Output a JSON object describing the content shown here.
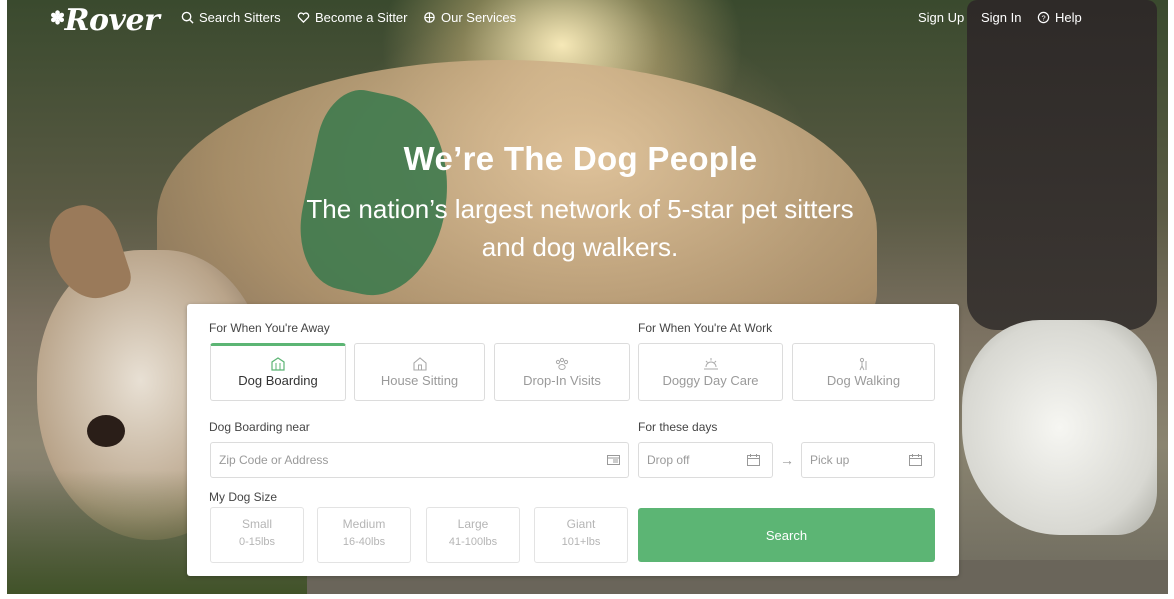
{
  "nav": {
    "logo": "Rover",
    "search_sitters": "Search Sitters",
    "become_sitter": "Become a Sitter",
    "our_services": "Our Services",
    "sign_up": "Sign Up",
    "sign_in": "Sign In",
    "help": "Help"
  },
  "hero": {
    "headline": "We’re The Dog People",
    "subline": "The nation’s largest network of 5-star pet sitters and dog walkers."
  },
  "search_card": {
    "away_label": "For When You're Away",
    "work_label": "For When You're At Work",
    "services": [
      {
        "label": "Dog Boarding",
        "icon": "house-bed-icon",
        "active": true
      },
      {
        "label": "House Sitting",
        "icon": "house-icon",
        "active": false
      },
      {
        "label": "Drop-In Visits",
        "icon": "paw-icon",
        "active": false
      },
      {
        "label": "Doggy Day Care",
        "icon": "sun-icon",
        "active": false
      },
      {
        "label": "Dog Walking",
        "icon": "walk-icon",
        "active": false
      }
    ],
    "location_label": "Dog Boarding near",
    "location_placeholder": "Zip Code or Address",
    "days_label": "For these days",
    "drop_off_placeholder": "Drop off",
    "pick_up_placeholder": "Pick up",
    "date_arrow": "→",
    "size_label": "My Dog Size",
    "sizes": [
      {
        "name": "Small",
        "weight": "0-15lbs"
      },
      {
        "name": "Medium",
        "weight": "16-40lbs"
      },
      {
        "name": "Large",
        "weight": "41-100lbs"
      },
      {
        "name": "Giant",
        "weight": "101+lbs"
      }
    ],
    "search_button": "Search"
  },
  "colors": {
    "accent_green": "#5cb574",
    "text_dark": "#333333",
    "text_muted": "#9a9a9a"
  }
}
